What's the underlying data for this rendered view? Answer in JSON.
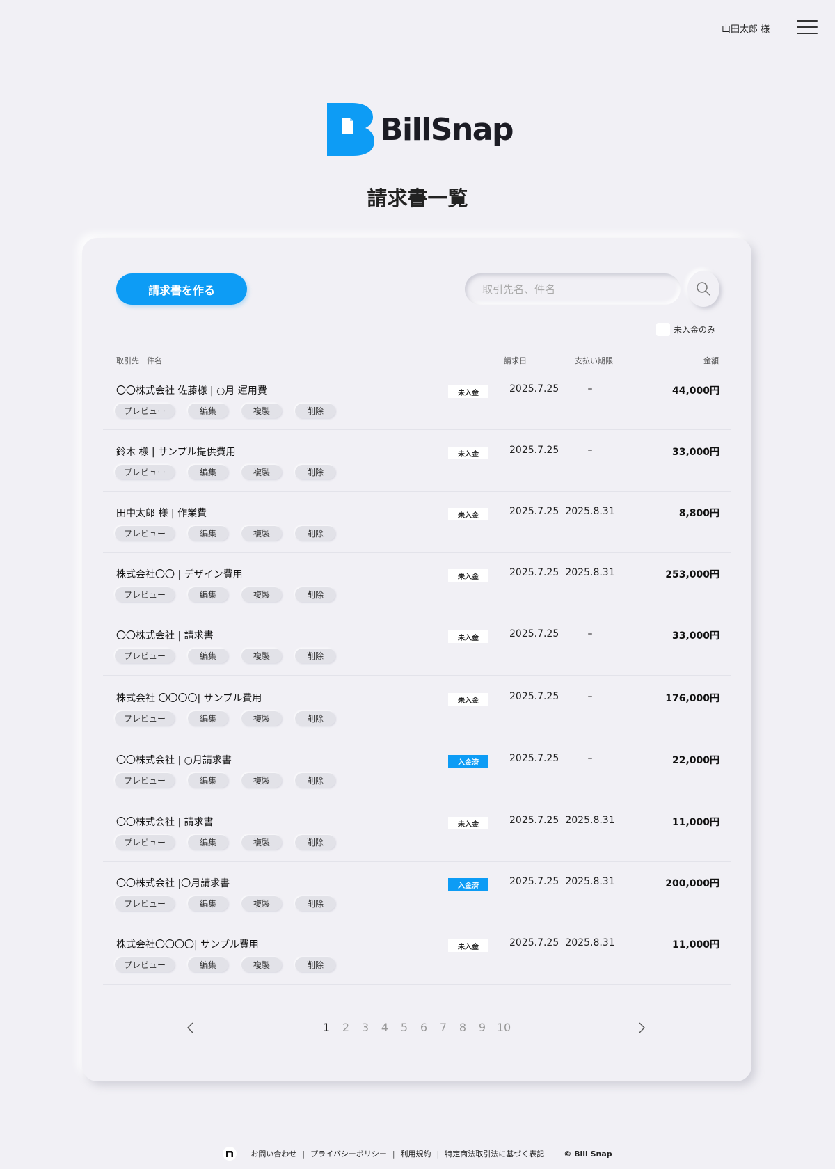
{
  "header": {
    "user_name": "山田太郎 様",
    "menu_icon": "hamburger-icon"
  },
  "brand": {
    "name": "BillSnap",
    "color": "#0d9cf5"
  },
  "page_title": "請求書一覧",
  "toolbar": {
    "create_label": "請求書を作る",
    "search_placeholder": "取引先名、件名",
    "search_icon": "search-icon",
    "filter_label": "未入金のみ"
  },
  "table": {
    "headers": {
      "client_subject": "取引先｜件名",
      "issue_date": "請求日",
      "due_date": "支払い期限",
      "amount": "金額"
    },
    "actions": {
      "preview": "プレビュー",
      "edit": "編集",
      "duplicate": "複製",
      "delete": "削除"
    },
    "rows": [
      {
        "title": "〇〇株式会社 佐藤様 | ○月 運用費",
        "status": "未入金",
        "paid": false,
        "issue_date": "2025.7.25",
        "due_date": "–",
        "amount": "44,000円"
      },
      {
        "title": "鈴木 様 | サンプル提供費用",
        "status": "未入金",
        "paid": false,
        "issue_date": "2025.7.25",
        "due_date": "–",
        "amount": "33,000円"
      },
      {
        "title": "田中太郎 様 | 作業費",
        "status": "未入金",
        "paid": false,
        "issue_date": "2025.7.25",
        "due_date": "2025.8.31",
        "amount": "8,800円"
      },
      {
        "title": "株式会社〇〇 | デザイン費用",
        "status": "未入金",
        "paid": false,
        "issue_date": "2025.7.25",
        "due_date": "2025.8.31",
        "amount": "253,000円"
      },
      {
        "title": "〇〇株式会社 | 請求書",
        "status": "未入金",
        "paid": false,
        "issue_date": "2025.7.25",
        "due_date": "–",
        "amount": "33,000円"
      },
      {
        "title": "株式会社 〇〇〇〇| サンプル費用",
        "status": "未入金",
        "paid": false,
        "issue_date": "2025.7.25",
        "due_date": "–",
        "amount": "176,000円"
      },
      {
        "title": "〇〇株式会社 | ○月請求書",
        "status": "入金済",
        "paid": true,
        "issue_date": "2025.7.25",
        "due_date": "–",
        "amount": "22,000円"
      },
      {
        "title": "〇〇株式会社 | 請求書",
        "status": "未入金",
        "paid": false,
        "issue_date": "2025.7.25",
        "due_date": "2025.8.31",
        "amount": "11,000円"
      },
      {
        "title": "〇〇株式会社 |〇月請求書",
        "status": "入金済",
        "paid": true,
        "issue_date": "2025.7.25",
        "due_date": "2025.8.31",
        "amount": "200,000円"
      },
      {
        "title": "株式会社〇〇〇〇| サンプル費用",
        "status": "未入金",
        "paid": false,
        "issue_date": "2025.7.25",
        "due_date": "2025.8.31",
        "amount": "11,000円"
      }
    ]
  },
  "pagination": {
    "pages": [
      "1",
      "2",
      "3",
      "4",
      "5",
      "6",
      "7",
      "8",
      "9",
      "10"
    ],
    "current": "1",
    "prev_icon": "chevron-left-icon",
    "next_icon": "chevron-right-icon"
  },
  "footer": {
    "logo_icon": "note-logo-icon",
    "links": [
      "お問い合わせ",
      "プライバシーポリシー",
      "利用規約",
      "特定商法取引法に基づく表記"
    ],
    "copyright": "© Bill Snap"
  }
}
